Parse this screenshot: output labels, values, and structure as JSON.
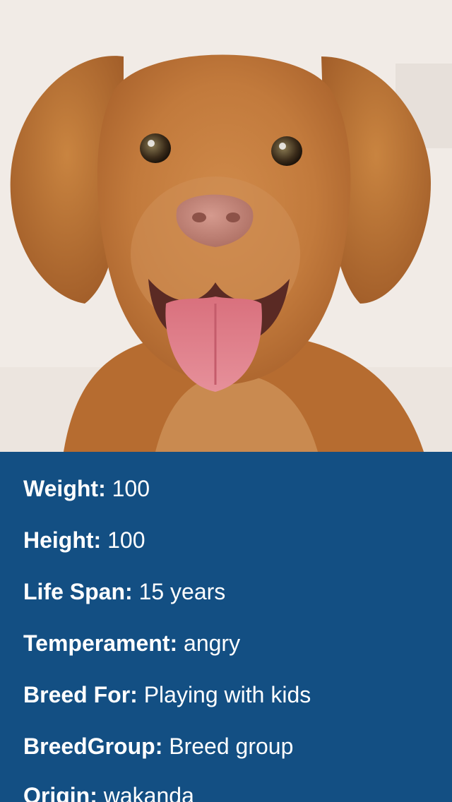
{
  "photo": {
    "subject": "dog-photo"
  },
  "details": [
    {
      "label": "Weight:",
      "value": "100"
    },
    {
      "label": "Height:",
      "value": "100"
    },
    {
      "label": "Life Span:",
      "value": "15 years"
    },
    {
      "label": "Temperament:",
      "value": "angry"
    },
    {
      "label": "Breed For:",
      "value": "Playing with kids"
    },
    {
      "label": "BreedGroup:",
      "value": "Breed group"
    },
    {
      "label": "Origin:",
      "value": "wakanda"
    }
  ],
  "colors": {
    "panel_background": "#134f83",
    "text": "#ffffff"
  }
}
